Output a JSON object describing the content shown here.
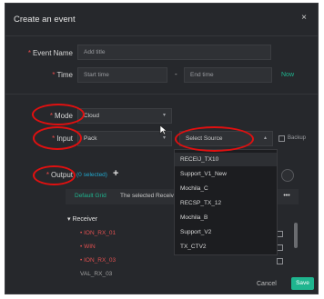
{
  "dialog": {
    "title": "Create an event",
    "close_label": "×"
  },
  "event_name": {
    "label": "Event Name",
    "placeholder": "Add title"
  },
  "time": {
    "label": "Time",
    "start_placeholder": "Start time",
    "separator": "-",
    "end_placeholder": "End time",
    "now_label": "Now"
  },
  "mode": {
    "label": "Mode",
    "value": "Cloud"
  },
  "input": {
    "label": "Input",
    "value": "Pack",
    "source_placeholder": "Select Source",
    "backup_label": "Backup"
  },
  "source_dropdown": {
    "options": [
      "RECEIJ_TX10",
      "Support_V1_New",
      "Mochila_C",
      "RECSP_TX_12",
      "Mochila_B",
      "Support_V2",
      "TX_CTV2"
    ]
  },
  "output": {
    "label": "Output",
    "hint": "(0 selected)",
    "plus": "+",
    "tabs": {
      "grid_label": "Default Grid",
      "selected_label": "The selected Receiver",
      "more_label": "•••"
    },
    "tree": {
      "header": "Receiver",
      "items": [
        "ION_RX_01",
        "WIN",
        "ION_RX_03",
        "VAL_RX_03"
      ]
    }
  },
  "footer": {
    "cancel_label": "Cancel",
    "save_label": "Save"
  },
  "colors": {
    "accent": "#1fb58f",
    "required": "#e64b4b",
    "annotation": "#e01010",
    "background": "#26282c"
  }
}
